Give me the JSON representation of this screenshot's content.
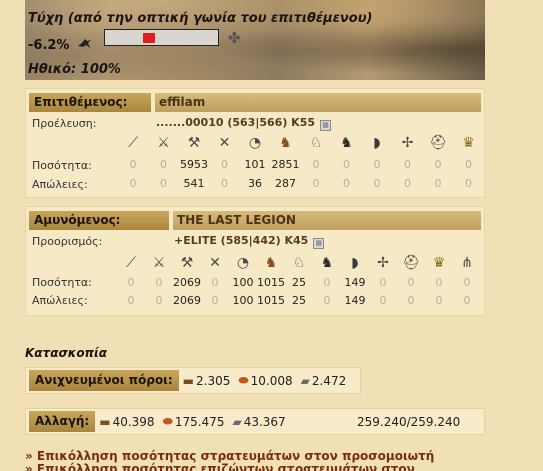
{
  "luck": {
    "title": "Τύχη (από την οπτική γωνία του επιτιθέμενου)",
    "percent": "-6.2%",
    "bar_position": -0.062,
    "bad_icon": "raven-icon",
    "good_icon": "clover-icon",
    "morale": "Ηθικό: 100%"
  },
  "attacker": {
    "label": "Επιτιθέμενος:",
    "name": "effilam",
    "origin_label": "Προέλευση:",
    "origin_value": ".......00010 (563|566) K55",
    "quantity_label": "Ποσότητα:",
    "losses_label": "Απώλειες:",
    "units": [
      "spear-icon",
      "sword-icon",
      "axe-icon",
      "archer-icon",
      "spy-icon",
      "light-cavalry-icon",
      "mounted-archer-icon",
      "heavy-cavalry-icon",
      "ram-icon",
      "catapult-icon",
      "knight-icon",
      "noble-icon"
    ],
    "quantity": [
      "0",
      "0",
      "5953",
      "0",
      "101",
      "2851",
      "0",
      "0",
      "0",
      "0",
      "0",
      "0"
    ],
    "losses": [
      "0",
      "0",
      "541",
      "0",
      "36",
      "287",
      "0",
      "0",
      "0",
      "0",
      "0",
      "0"
    ]
  },
  "defender": {
    "label": "Αμυνόμενος:",
    "name": "THE LAST LEGION",
    "target_label": "Προορισμός:",
    "target_value": "+ELITE (585|442) K45",
    "quantity_label": "Ποσότητα:",
    "losses_label": "Απώλειες:",
    "units": [
      "spear-icon",
      "sword-icon",
      "axe-icon",
      "archer-icon",
      "spy-icon",
      "light-cavalry-icon",
      "mounted-archer-icon",
      "heavy-cavalry-icon",
      "ram-icon",
      "catapult-icon",
      "knight-icon",
      "noble-icon",
      "militia-icon"
    ],
    "quantity": [
      "0",
      "0",
      "2069",
      "0",
      "100",
      "1015",
      "25",
      "0",
      "149",
      "0",
      "0",
      "0",
      "0"
    ],
    "losses": [
      "0",
      "0",
      "2069",
      "0",
      "100",
      "1015",
      "25",
      "0",
      "149",
      "0",
      "0",
      "0",
      "0"
    ]
  },
  "espionage": {
    "title": "Κατασκοπία",
    "resources_label": "Ανιχνευμένοι πόροι:",
    "wood": "2.305",
    "clay": "10.008",
    "iron": "2.472"
  },
  "change": {
    "label": "Αλλαγή:",
    "wood": "40.398",
    "clay": "175.475",
    "iron": "43.367",
    "ratio": "259.240/259.240"
  },
  "links": {
    "simulator_1": "» Επικόλληση ποσότητας στρατευμάτων στον προσομοιωτή",
    "simulator_2": "» Επικόλληση ποσότητας επιζώντων στρατευμάτων στον"
  },
  "colors": {
    "background": "#f1e0b5",
    "header_gold": "#c9a55a",
    "luck_bar_fill": "#e02020",
    "link_color": "#7a2e0e"
  }
}
